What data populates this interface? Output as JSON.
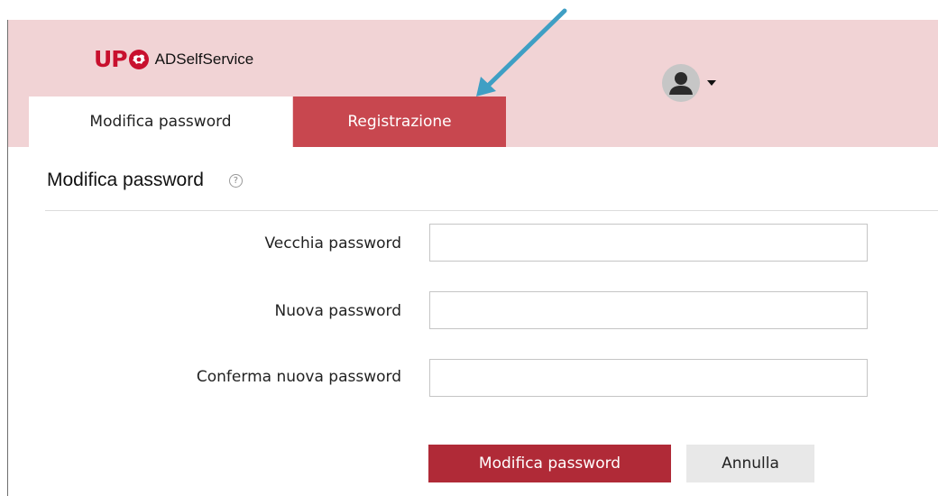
{
  "brand": {
    "logo_text": "UP",
    "service_name": "ADSelfService",
    "accent": "#c8102e"
  },
  "colors": {
    "header_bg": "#f1d3d5",
    "tab_inactive_bg": "#c8474f",
    "primary_button_bg": "#b02a37",
    "annotation_arrow": "#3f9fc4"
  },
  "user_menu": {
    "icon": "user-avatar-icon",
    "caret_icon": "caret-down-icon"
  },
  "tabs": [
    {
      "label": "Modifica password",
      "active": true
    },
    {
      "label": "Registrazione",
      "active": false
    }
  ],
  "section": {
    "title": "Modifica password",
    "help_icon": "question-circle-icon",
    "help_glyph": "?"
  },
  "form": {
    "fields": [
      {
        "label": "Vecchia password",
        "value": "",
        "placeholder": ""
      },
      {
        "label": "Nuova password",
        "value": "",
        "placeholder": ""
      },
      {
        "label": "Conferma nuova password",
        "value": "",
        "placeholder": ""
      }
    ],
    "submit_label": "Modifica password",
    "cancel_label": "Annulla"
  }
}
